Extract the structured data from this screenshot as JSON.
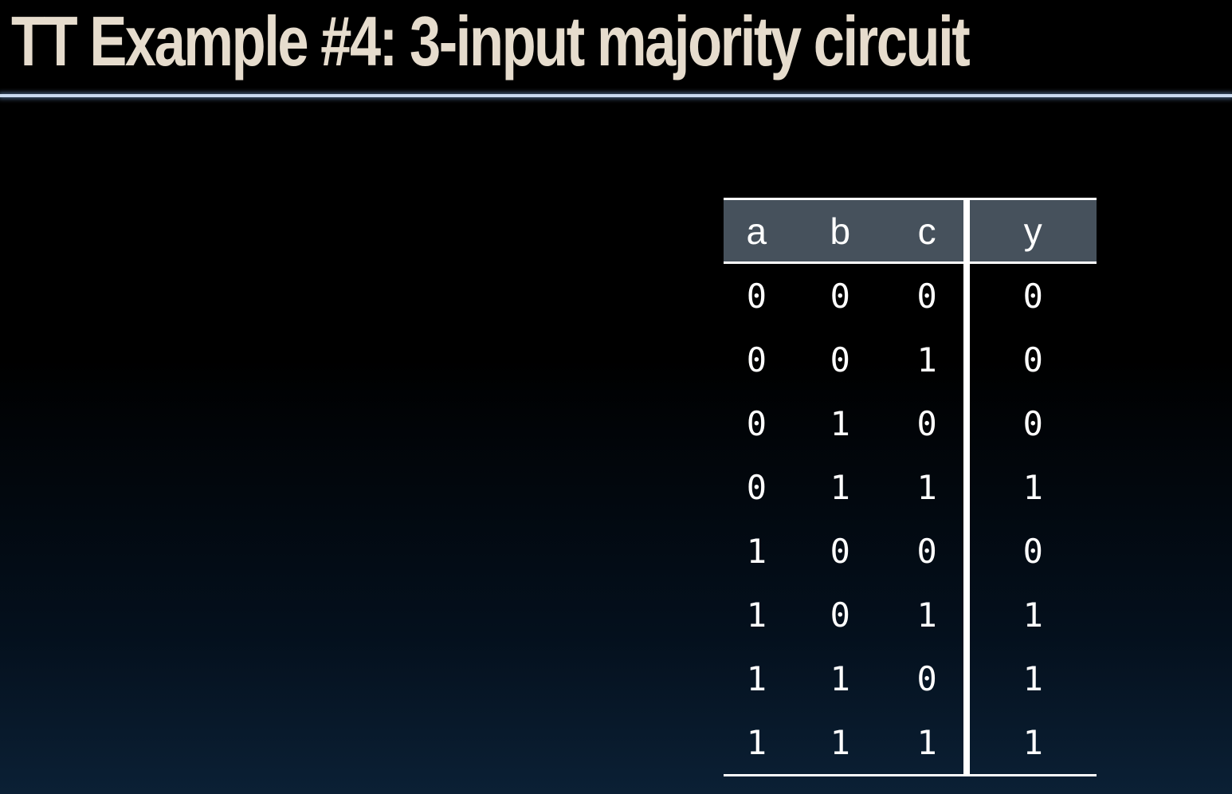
{
  "slide": {
    "title": "TT Example #4: 3-input majority circuit"
  },
  "table": {
    "headers": [
      "a",
      "b",
      "c",
      "y"
    ],
    "rows": [
      [
        "0",
        "0",
        "0",
        "0"
      ],
      [
        "0",
        "0",
        "1",
        "0"
      ],
      [
        "0",
        "1",
        "0",
        "0"
      ],
      [
        "0",
        "1",
        "1",
        "1"
      ],
      [
        "1",
        "0",
        "0",
        "0"
      ],
      [
        "1",
        "0",
        "1",
        "1"
      ],
      [
        "1",
        "1",
        "0",
        "1"
      ],
      [
        "1",
        "1",
        "1",
        "1"
      ]
    ]
  }
}
